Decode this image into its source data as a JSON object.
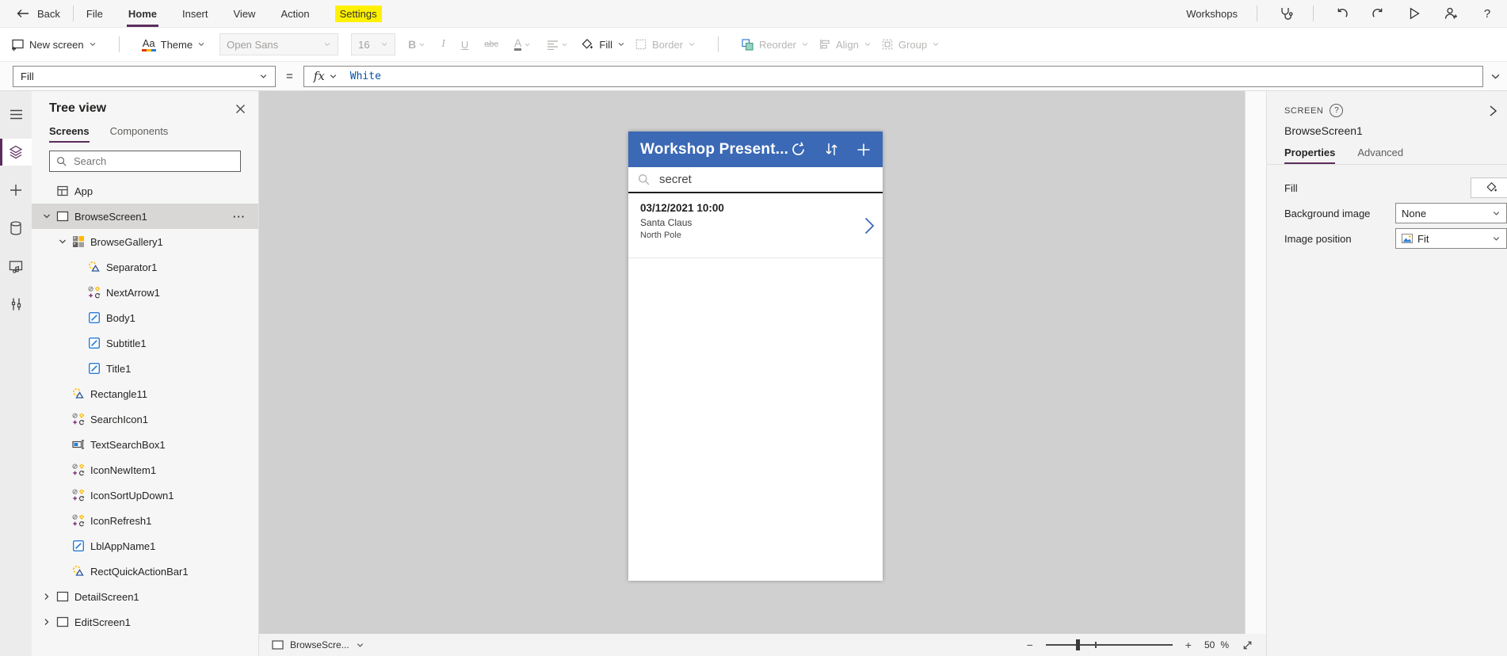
{
  "menu_bar": {
    "back_label": "Back",
    "items": [
      {
        "label": "File"
      },
      {
        "label": "Home"
      },
      {
        "label": "Insert"
      },
      {
        "label": "View"
      },
      {
        "label": "Action"
      },
      {
        "label": "Settings"
      }
    ],
    "environment_label": "Workshops"
  },
  "toolbar": {
    "new_screen_label": "New screen",
    "theme_label": "Theme",
    "font_name": "Open Sans",
    "font_size": "16",
    "bold_label": "B",
    "italic_label": "I",
    "underline_label": "U",
    "strikethrough_label": "abc",
    "font_color_label": "A",
    "fill_label": "Fill",
    "border_label": "Border",
    "reorder_label": "Reorder",
    "align_label": "Align",
    "group_label": "Group"
  },
  "formula_bar": {
    "property_name": "Fill",
    "equals_sign": "=",
    "fx_label": "fx",
    "formula_value": "White"
  },
  "tree_panel": {
    "title": "Tree view",
    "tabs": [
      {
        "label": "Screens"
      },
      {
        "label": "Components"
      }
    ],
    "search_placeholder": "Search",
    "items": [
      {
        "label": "App",
        "icon": "app",
        "indent": 0
      },
      {
        "label": "BrowseScreen1",
        "icon": "screen",
        "indent": 0,
        "chevron": "down",
        "selected": true,
        "dots": true
      },
      {
        "label": "BrowseGallery1",
        "icon": "gallery",
        "indent": 1,
        "chevron": "down"
      },
      {
        "label": "Separator1",
        "icon": "shape",
        "indent": 2
      },
      {
        "label": "NextArrow1",
        "icon": "iconset",
        "indent": 2
      },
      {
        "label": "Body1",
        "icon": "label",
        "indent": 2
      },
      {
        "label": "Subtitle1",
        "icon": "label",
        "indent": 2
      },
      {
        "label": "Title1",
        "icon": "label",
        "indent": 2
      },
      {
        "label": "Rectangle11",
        "icon": "shape",
        "indent": 1
      },
      {
        "label": "SearchIcon1",
        "icon": "iconset",
        "indent": 1
      },
      {
        "label": "TextSearchBox1",
        "icon": "textbox",
        "indent": 1
      },
      {
        "label": "IconNewItem1",
        "icon": "iconset",
        "indent": 1
      },
      {
        "label": "IconSortUpDown1",
        "icon": "iconset",
        "indent": 1
      },
      {
        "label": "IconRefresh1",
        "icon": "iconset",
        "indent": 1
      },
      {
        "label": "LblAppName1",
        "icon": "label",
        "indent": 1
      },
      {
        "label": "RectQuickActionBar1",
        "icon": "shape",
        "indent": 1
      },
      {
        "label": "DetailScreen1",
        "icon": "screen",
        "indent": 0,
        "chevron": "right"
      },
      {
        "label": "EditScreen1",
        "icon": "screen",
        "indent": 0,
        "chevron": "right"
      }
    ]
  },
  "phone": {
    "header_title": "Workshop Present...",
    "search_text": "secret",
    "list_item": {
      "title": "03/12/2021 10:00",
      "subtitle": "Santa Claus",
      "body": "North Pole"
    }
  },
  "bottom_bar": {
    "screen_selector_label": "BrowseScre...",
    "zoom_out": "−",
    "zoom_in": "+",
    "zoom_value": "50",
    "zoom_unit": "%"
  },
  "properties_panel": {
    "header_type": "SCREEN",
    "help_mark": "?",
    "name": "BrowseScreen1",
    "tabs": [
      {
        "label": "Properties"
      },
      {
        "label": "Advanced"
      }
    ],
    "fill_label": "Fill",
    "background_image_label": "Background image",
    "background_image_value": "None",
    "image_position_label": "Image position",
    "image_position_value": "Fit"
  },
  "colors": {
    "accent_purple": "#5c2d5c",
    "phone_header_blue": "#3b69b5",
    "highlight_yellow": "#fff100",
    "formula_text_blue": "#0451a5"
  }
}
